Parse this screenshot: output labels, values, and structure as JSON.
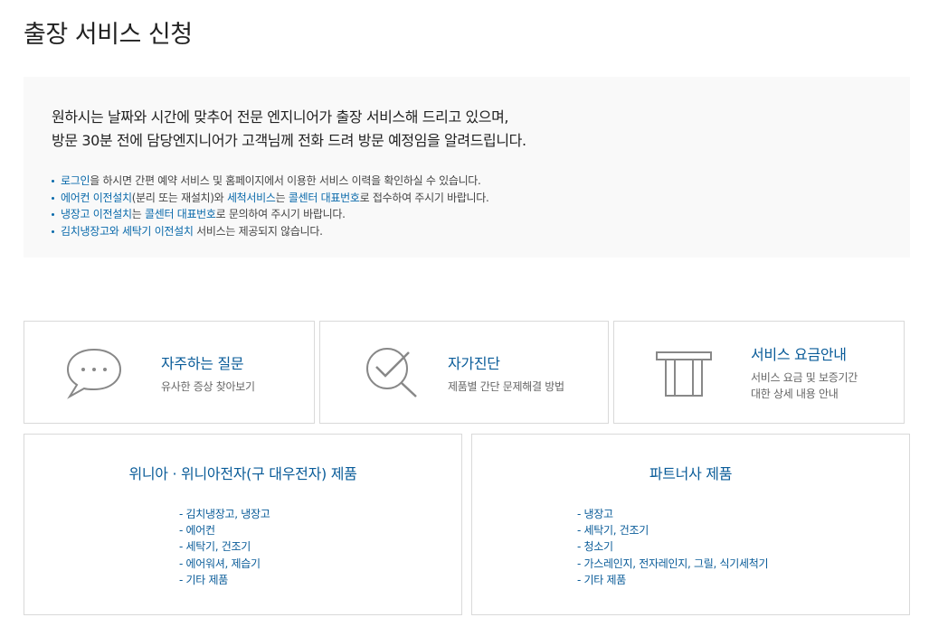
{
  "page": {
    "title": "출장 서비스 신청"
  },
  "notice": {
    "lead_line1": "원하시는 날짜와 시간에 맞추어 전문 엔지니어가 출장 서비스해 드리고 있으며,",
    "lead_line2": "방문 30분 전에 담당엔지니어가 고객님께 전화 드려 방문 예정임을 알려드립니다.",
    "bullets": [
      {
        "parts": [
          {
            "t": "로그인",
            "hl": true
          },
          {
            "t": "을 하시면 간편 예약 서비스 및 홈페이지에서 이용한 서비스 이력을 확인하실 수 있습니다.",
            "hl": false
          }
        ]
      },
      {
        "parts": [
          {
            "t": "에어컨 이전설치",
            "hl": true
          },
          {
            "t": "(분리 또는 재설치)와 ",
            "hl": false
          },
          {
            "t": "세척서비스",
            "hl": true
          },
          {
            "t": "는 ",
            "hl": false
          },
          {
            "t": "콜센터 대표번호",
            "hl": true
          },
          {
            "t": "로 접수하여 주시기 바랍니다.",
            "hl": false
          }
        ]
      },
      {
        "parts": [
          {
            "t": "냉장고 이전설치",
            "hl": true
          },
          {
            "t": "는 ",
            "hl": false
          },
          {
            "t": "콜센터 대표번호",
            "hl": true
          },
          {
            "t": "로 문의하여 주시기 바랍니다.",
            "hl": false
          }
        ]
      },
      {
        "parts": [
          {
            "t": "김치냉장고와 세탁기 이전설치",
            "hl": true
          },
          {
            "t": " 서비스는 제공되지 않습니다.",
            "hl": false
          }
        ]
      }
    ]
  },
  "cards": {
    "faq": {
      "title": "자주하는 질문",
      "desc": "유사한 증상 찾아보기",
      "icon": "speech-bubble-icon"
    },
    "diagnosis": {
      "title": "자가진단",
      "desc": "제품별 간단 문제해결 방법",
      "icon": "magnifier-check-icon"
    },
    "pricing": {
      "title": "서비스 요금안내",
      "desc_line1": "서비스 요금 및 보증기간",
      "desc_line2": "대한 상세 내용 안내",
      "icon": "receipt-icon"
    }
  },
  "products": {
    "winia": {
      "title": "위니아 · 위니아전자(구 대우전자) 제품",
      "items": [
        "- 김치냉장고, 냉장고",
        "- 에어컨",
        "- 세탁기, 건조기",
        "- 에어워셔, 제습기",
        "- 기타 제품"
      ]
    },
    "partner": {
      "title": "파트너사 제품",
      "items": [
        "- 냉장고",
        "- 세탁기, 건조기",
        "- 청소기",
        "- 가스레인지, 전자레인지, 그릴, 식기세척기",
        "- 기타 제품"
      ]
    }
  },
  "colors": {
    "accent": "#0a5c99",
    "bullet": "#0a6aab",
    "border": "#d9d9d9",
    "notice_bg": "#f9f9f9"
  }
}
